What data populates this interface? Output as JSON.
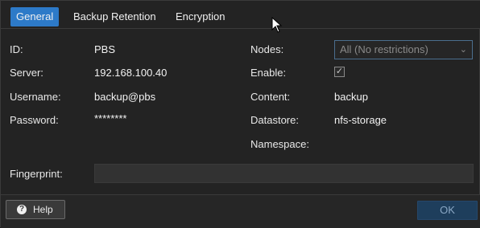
{
  "tabs": [
    {
      "label": "General"
    },
    {
      "label": "Backup Retention"
    },
    {
      "label": "Encryption"
    }
  ],
  "left_fields": {
    "id": {
      "label": "ID:",
      "value": "PBS"
    },
    "server": {
      "label": "Server:",
      "value": "192.168.100.40"
    },
    "username": {
      "label": "Username:",
      "value": "backup@pbs"
    },
    "password": {
      "label": "Password:",
      "value": "********"
    }
  },
  "right_fields": {
    "nodes": {
      "label": "Nodes:",
      "value": "All (No restrictions)"
    },
    "enable": {
      "label": "Enable:",
      "checked": true
    },
    "content": {
      "label": "Content:",
      "value": "backup"
    },
    "datastore": {
      "label": "Datastore:",
      "value": "nfs-storage"
    },
    "namespace": {
      "label": "Namespace:",
      "value": ""
    }
  },
  "fingerprint": {
    "label": "Fingerprint:",
    "value": ""
  },
  "footer": {
    "help_label": "Help",
    "ok_label": "OK"
  },
  "icons": {
    "help": "question-circle-icon",
    "dropdown": "chevron-down-icon",
    "check": "check-icon",
    "cursor": "mouse-pointer-icon"
  }
}
